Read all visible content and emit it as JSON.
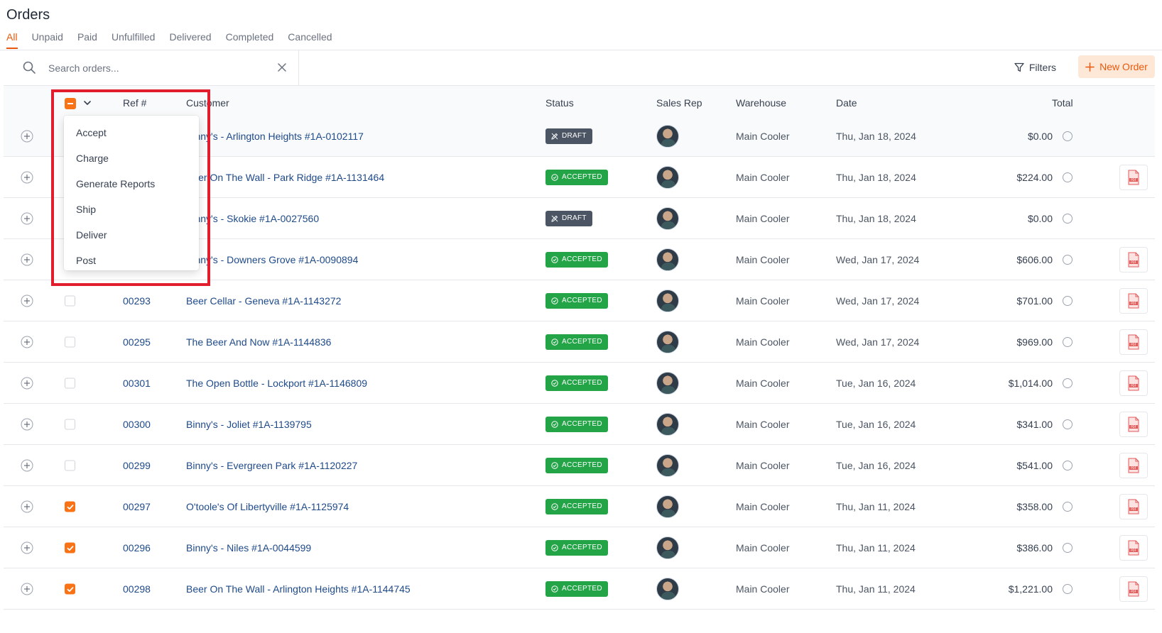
{
  "page": {
    "title": "Orders"
  },
  "tabs": [
    "All",
    "Unpaid",
    "Paid",
    "Unfulfilled",
    "Delivered",
    "Completed",
    "Cancelled"
  ],
  "active_tab": "All",
  "search": {
    "placeholder": "Search orders...",
    "value": ""
  },
  "toolbar": {
    "filters_label": "Filters",
    "new_order_label": "New Order"
  },
  "columns": {
    "ref": "Ref #",
    "customer": "Customer",
    "status": "Status",
    "sales_rep": "Sales Rep",
    "warehouse": "Warehouse",
    "date": "Date",
    "total": "Total"
  },
  "bulk_menu": {
    "items": [
      "Accept",
      "Charge",
      "Generate Reports",
      "Ship",
      "Deliver",
      "Post"
    ]
  },
  "colors": {
    "accent": "#ea580c",
    "accepted": "#22a447",
    "draft": "#4b5563",
    "link": "#1e4a8a",
    "highlight": "#e11d2e"
  },
  "orders": [
    {
      "ref": "",
      "customer": "Binny's - Arlington Heights #1A-0102117",
      "status": "DRAFT",
      "warehouse": "Main Cooler",
      "date": "Thu, Jan 18, 2024",
      "total": "$0.00",
      "checked": false,
      "pdf": false
    },
    {
      "ref": "",
      "customer": "Beer On The Wall - Park Ridge #1A-1131464",
      "status": "ACCEPTED",
      "warehouse": "Main Cooler",
      "date": "Thu, Jan 18, 2024",
      "total": "$224.00",
      "checked": false,
      "pdf": true
    },
    {
      "ref": "",
      "customer": "Binny's - Skokie #1A-0027560",
      "status": "DRAFT",
      "warehouse": "Main Cooler",
      "date": "Thu, Jan 18, 2024",
      "total": "$0.00",
      "checked": false,
      "pdf": false
    },
    {
      "ref": "",
      "customer": "Binny's - Downers Grove #1A-0090894",
      "status": "ACCEPTED",
      "warehouse": "Main Cooler",
      "date": "Wed, Jan 17, 2024",
      "total": "$606.00",
      "checked": false,
      "pdf": true
    },
    {
      "ref": "00293",
      "customer": "Beer Cellar - Geneva #1A-1143272",
      "status": "ACCEPTED",
      "warehouse": "Main Cooler",
      "date": "Wed, Jan 17, 2024",
      "total": "$701.00",
      "checked": false,
      "pdf": true
    },
    {
      "ref": "00295",
      "customer": "The Beer And Now #1A-1144836",
      "status": "ACCEPTED",
      "warehouse": "Main Cooler",
      "date": "Wed, Jan 17, 2024",
      "total": "$969.00",
      "checked": false,
      "pdf": true
    },
    {
      "ref": "00301",
      "customer": "The Open Bottle - Lockport #1A-1146809",
      "status": "ACCEPTED",
      "warehouse": "Main Cooler",
      "date": "Tue, Jan 16, 2024",
      "total": "$1,014.00",
      "checked": false,
      "pdf": true
    },
    {
      "ref": "00300",
      "customer": "Binny's - Joliet #1A-1139795",
      "status": "ACCEPTED",
      "warehouse": "Main Cooler",
      "date": "Tue, Jan 16, 2024",
      "total": "$341.00",
      "checked": false,
      "pdf": true
    },
    {
      "ref": "00299",
      "customer": "Binny's - Evergreen Park #1A-1120227",
      "status": "ACCEPTED",
      "warehouse": "Main Cooler",
      "date": "Tue, Jan 16, 2024",
      "total": "$541.00",
      "checked": false,
      "pdf": true
    },
    {
      "ref": "00297",
      "customer": "O'toole's Of Libertyville #1A-1125974",
      "status": "ACCEPTED",
      "warehouse": "Main Cooler",
      "date": "Thu, Jan 11, 2024",
      "total": "$358.00",
      "checked": true,
      "pdf": true
    },
    {
      "ref": "00296",
      "customer": "Binny's - Niles #1A-0044599",
      "status": "ACCEPTED",
      "warehouse": "Main Cooler",
      "date": "Thu, Jan 11, 2024",
      "total": "$386.00",
      "checked": true,
      "pdf": true
    },
    {
      "ref": "00298",
      "customer": "Beer On The Wall - Arlington Heights #1A-1144745",
      "status": "ACCEPTED",
      "warehouse": "Main Cooler",
      "date": "Thu, Jan 11, 2024",
      "total": "$1,221.00",
      "checked": true,
      "pdf": true
    }
  ]
}
